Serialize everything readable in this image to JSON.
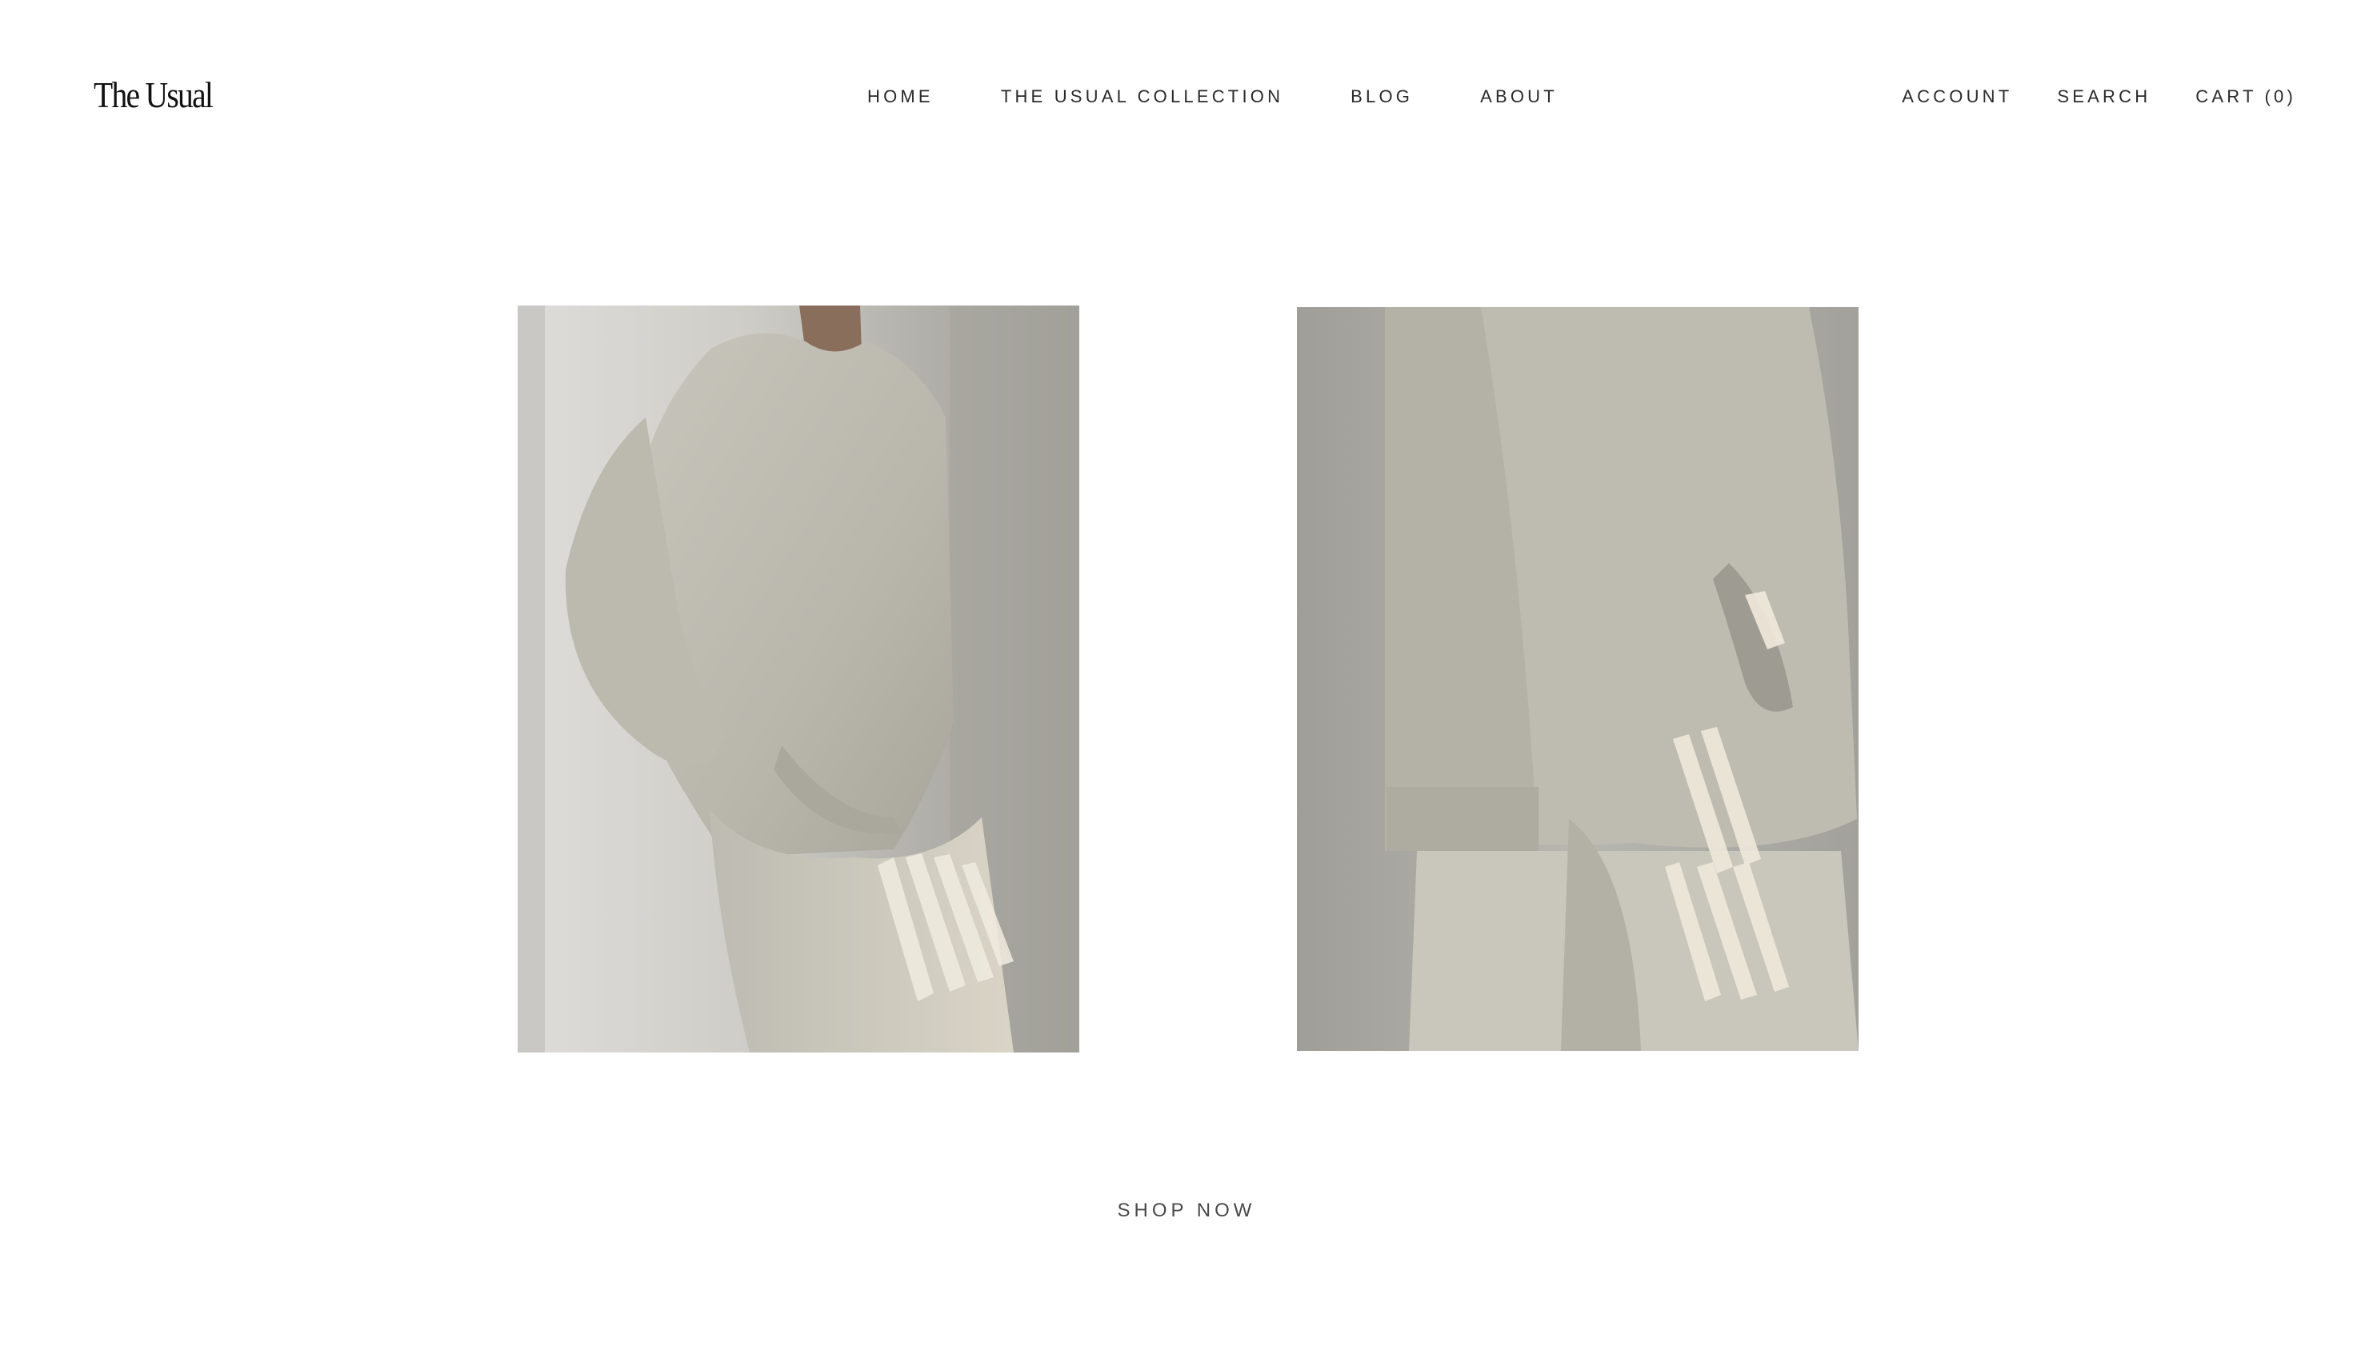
{
  "brand": {
    "logo_text": "The Usual"
  },
  "nav": {
    "items": [
      {
        "label": "HOME"
      },
      {
        "label": "THE USUAL COLLECTION"
      },
      {
        "label": "BLOG"
      },
      {
        "label": "ABOUT"
      }
    ]
  },
  "utility_nav": {
    "account": "ACCOUNT",
    "search": "SEARCH",
    "cart": "CART (0)"
  },
  "cta": {
    "label": "SHOP NOW"
  },
  "colors": {
    "background": "#ffffff",
    "text": "#1c1c1c",
    "wall": "#a7a59f",
    "fabric": "#c7c5ba",
    "light": "#efe9dc"
  }
}
